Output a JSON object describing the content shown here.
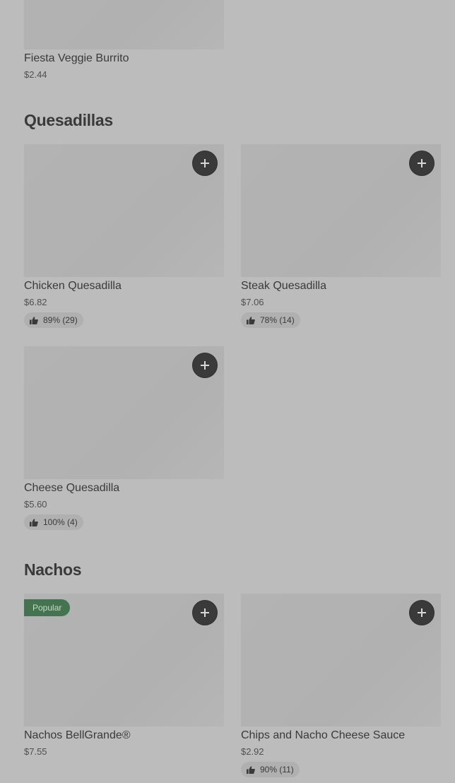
{
  "top_item": {
    "name": "Fiesta Veggie Burrito",
    "price": "$2.44"
  },
  "sections": [
    {
      "title": "Quesadillas",
      "items": [
        {
          "name": "Chicken Quesadilla",
          "price": "$6.82",
          "rating": "89% (29)"
        },
        {
          "name": "Steak Quesadilla",
          "price": "$7.06",
          "rating": "78% (14)"
        },
        {
          "name": "Cheese Quesadilla",
          "price": "$5.60",
          "rating": "100% (4)"
        }
      ]
    },
    {
      "title": "Nachos",
      "items": [
        {
          "name": "Nachos BellGrande®",
          "price": "$7.55",
          "badge": "Popular"
        },
        {
          "name": "Chips and Nacho Cheese Sauce",
          "price": "$2.92",
          "rating": "90% (11)"
        }
      ]
    }
  ],
  "icons": {
    "add": "plus-icon",
    "rating": "thumbs-up-icon"
  }
}
